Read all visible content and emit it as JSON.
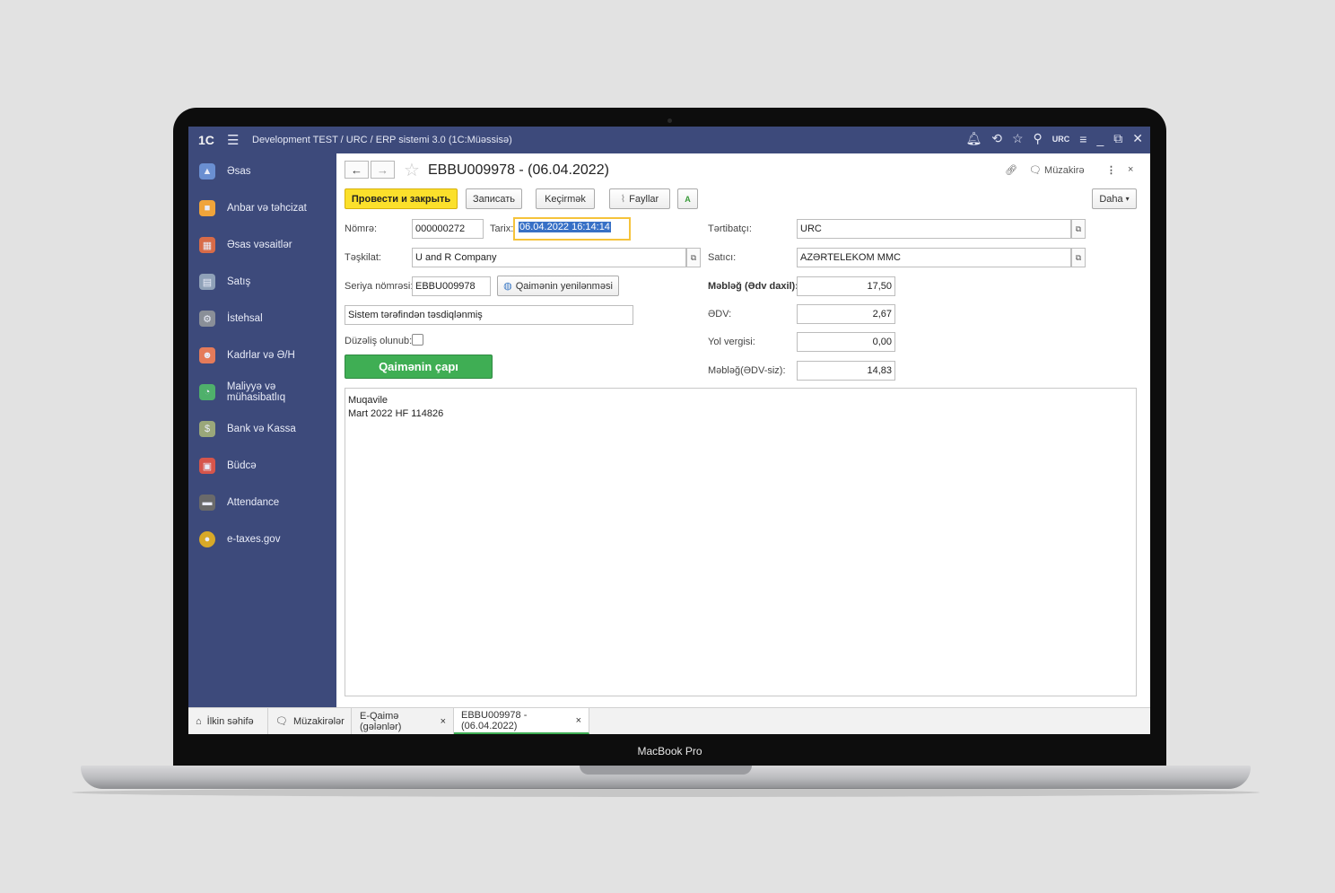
{
  "device": {
    "brand": "MacBook Pro"
  },
  "topbar": {
    "logo": "1C",
    "title": "Development TEST / URC / ERP sistemi 3.0  (1C:Müəssisə)",
    "user": "URC"
  },
  "sidebar": {
    "items": [
      {
        "label": "Əsas",
        "icon": "home-icon",
        "color": "#6a8fd1"
      },
      {
        "label": "Anbar və təhcizat",
        "icon": "box-icon",
        "color": "#f0a43a"
      },
      {
        "label": "Əsas vəsaitlər",
        "icon": "assets-icon",
        "color": "#d86b48"
      },
      {
        "label": "Satış",
        "icon": "cash-register-icon",
        "color": "#8fa1b8"
      },
      {
        "label": "İstehsal",
        "icon": "factory-icon",
        "color": "#8a8f98"
      },
      {
        "label": "Kadrlar və Ə/H",
        "icon": "people-icon",
        "color": "#e57b5a"
      },
      {
        "label": "Maliyyə və mühasibatlıq",
        "icon": "pie-chart-icon",
        "color": "#4fb06b"
      },
      {
        "label": "Bank və Kassa",
        "icon": "money-icon",
        "color": "#9aa77a"
      },
      {
        "label": "Büdcə",
        "icon": "calendar-icon",
        "color": "#d6554b"
      },
      {
        "label": "Attendance",
        "icon": "terminal-icon",
        "color": "#6a6a6a"
      },
      {
        "label": "e-taxes.gov",
        "icon": "emblem-icon",
        "color": "#d8a928"
      }
    ]
  },
  "header": {
    "title": "EBBU009978 - (06.04.2022)",
    "discuss": "Müzakirə"
  },
  "toolbar": {
    "post_close": "Провести и закрыть",
    "write": "Записать",
    "transfer": "Keçirmək",
    "files": "Fayllar",
    "more": "Daha"
  },
  "form": {
    "number_label": "Nömrə:",
    "number": "000000272",
    "date_label": "Tarix:",
    "date": "06.04.2022 16:14:14",
    "org_label": "Təşkilat:",
    "org": "U and R Company",
    "series_label": "Seriya nömrəsi:",
    "series": "EBBU009978",
    "refresh": "Qaimənin yenilənməsi",
    "status": "Sistem tərəfindən təsdiqlənmiş",
    "corrected_label": "Düzəliş olunub:",
    "print": "Qaimənin çapı",
    "author_label": "Tərtibatçı:",
    "author": "URC",
    "seller_label": "Satıcı:",
    "seller": "AZƏRTELEKOM MMC",
    "total_label": "Məbləğ (Ədv daxil):",
    "total": "17,50",
    "vat_label": "ƏDV:",
    "vat": "2,67",
    "road_label": "Yol vergisi:",
    "road": "0,00",
    "net_label": "Məbləğ(ƏDV-siz):",
    "net": "14,83",
    "memo_line1": "Muqavile",
    "memo_line2": "Mart 2022 HF 114826"
  },
  "tabs": {
    "home": "İlkin səhifə",
    "discussions": "Müzakirələr",
    "einvoice": "E-Qaimə (gələnlər)",
    "doc": "EBBU009978 - (06.04.2022)"
  }
}
